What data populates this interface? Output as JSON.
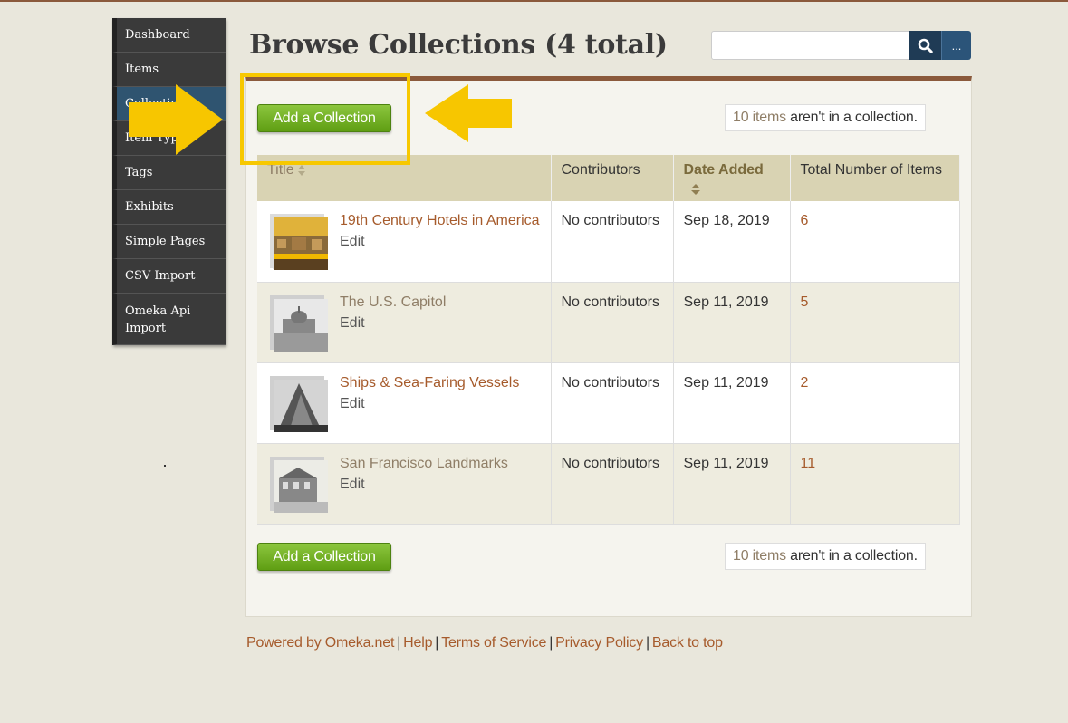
{
  "sidebar": {
    "items": [
      {
        "label": "Dashboard"
      },
      {
        "label": "Items"
      },
      {
        "label": "Collections"
      },
      {
        "label": "Item Types"
      },
      {
        "label": "Tags"
      },
      {
        "label": "Exhibits"
      },
      {
        "label": "Simple Pages"
      },
      {
        "label": "CSV Import"
      },
      {
        "label": "Omeka Api Import"
      }
    ]
  },
  "header": {
    "title": "Browse Collections (4 total)",
    "search_value": "",
    "advanced_label": "..."
  },
  "actions": {
    "add_label": "Add a Collection",
    "not_in_collection_count": "10 items",
    "not_in_collection_text": " aren't in a collection."
  },
  "table": {
    "headers": {
      "title": "Title",
      "contributors": "Contributors",
      "date_added": "Date Added",
      "total_items": "Total Number of Items"
    },
    "edit_label": "Edit",
    "rows": [
      {
        "title": "19th Century Hotels in America",
        "contributors": "No contributors",
        "date": "Sep 18, 2019",
        "count": "6"
      },
      {
        "title": "The U.S. Capitol",
        "contributors": "No contributors",
        "date": "Sep 11, 2019",
        "count": "5"
      },
      {
        "title": "Ships & Sea-Faring Vessels",
        "contributors": "No contributors",
        "date": "Sep 11, 2019",
        "count": "2"
      },
      {
        "title": "San Francisco Landmarks",
        "contributors": "No contributors",
        "date": "Sep 11, 2019",
        "count": "11"
      }
    ]
  },
  "footer": {
    "powered": "Powered by Omeka.net",
    "help": "Help",
    "terms": "Terms of Service",
    "privacy": "Privacy Policy",
    "top": "Back to top"
  },
  "colors": {
    "accent_brown": "#8b5a3c",
    "link": "#a65b2c",
    "button_green": "#6aab1e",
    "nav_dark": "#3a3a3a",
    "nav_active": "#2f5470",
    "annotation_yellow": "#f7c800"
  }
}
